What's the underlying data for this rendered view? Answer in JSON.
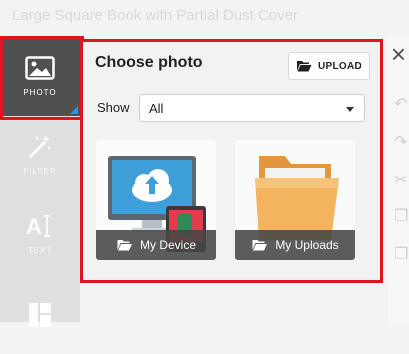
{
  "document": {
    "title": "Large Square Book with Partial Dust Cover"
  },
  "rail": {
    "items": [
      {
        "label": "PHOTO",
        "icon": "image-icon",
        "active": true
      },
      {
        "label": "FILTER",
        "icon": "magic-wand-icon",
        "active": false
      },
      {
        "label": "TEXT",
        "icon": "text-cursor-icon",
        "active": false
      },
      {
        "label": "",
        "icon": "layout-icon",
        "active": false
      }
    ]
  },
  "panel": {
    "title": "Choose photo",
    "upload_label": "UPLOAD",
    "show_label": "Show",
    "show_value": "All",
    "sources": [
      {
        "label": "My Device",
        "icon": "folder-open-icon"
      },
      {
        "label": "My Uploads",
        "icon": "folder-open-icon"
      }
    ]
  },
  "colors": {
    "highlight": "#e0141e",
    "accent": "#2196f3",
    "rail": "#dfdfdf",
    "rail_active": "#505050"
  }
}
